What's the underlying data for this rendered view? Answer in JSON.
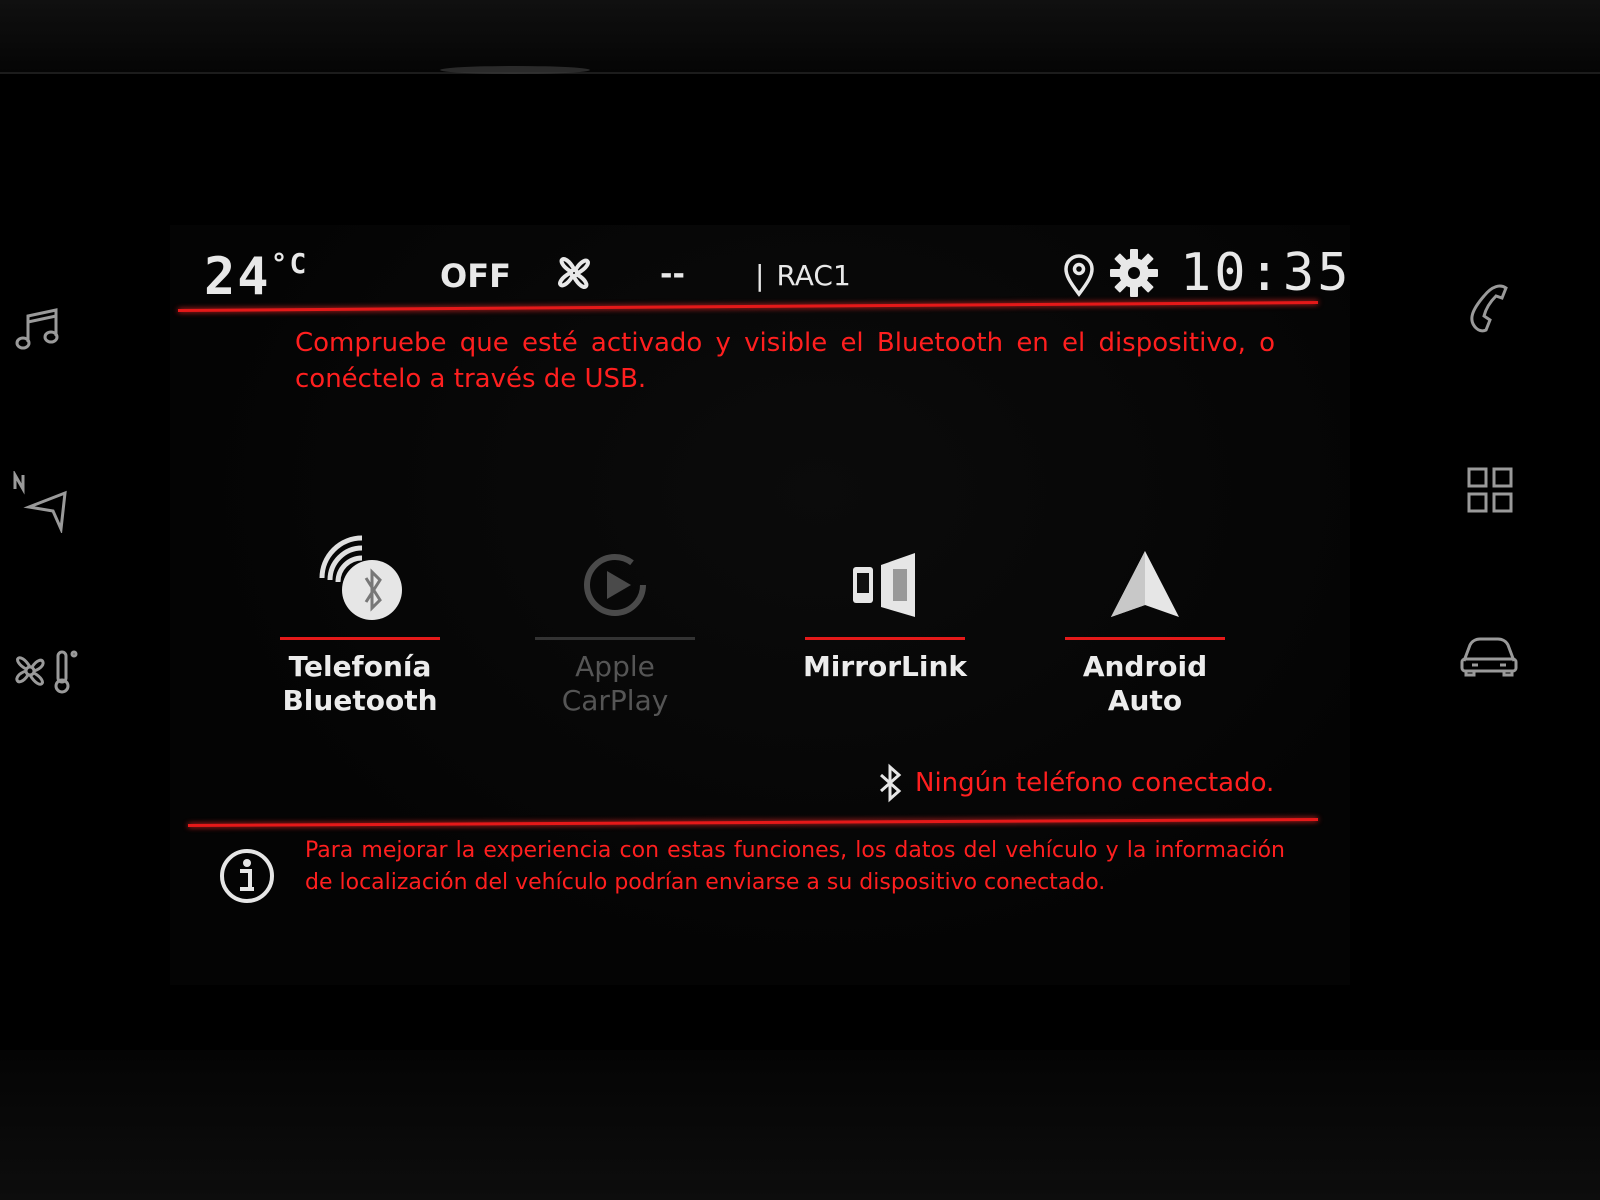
{
  "status_bar": {
    "temperature": "24",
    "temperature_unit": "°C",
    "fan_state": "OFF",
    "fan_level": "--",
    "radio_separator": "|",
    "radio_station": "RAC1",
    "clock": "10:35",
    "icons": [
      "fan-icon",
      "location-pin-icon",
      "gear-icon"
    ]
  },
  "alert_message": "Compruebe que esté activado y visible el Bluetooth en el dispositivo, o conéctelo a través de USB.",
  "connectivity_options": [
    {
      "label_line1": "Telefonía",
      "label_line2": "Bluetooth",
      "icon": "bluetooth-phone-icon",
      "enabled": true
    },
    {
      "label_line1": "Apple CarPlay",
      "label_line2": "",
      "icon": "carplay-icon",
      "enabled": false
    },
    {
      "label_line1": "MirrorLink",
      "label_line2": "",
      "icon": "mirrorlink-icon",
      "enabled": true
    },
    {
      "label_line1": "Android Auto",
      "label_line2": "",
      "icon": "android-auto-icon",
      "enabled": true
    }
  ],
  "phone_status": "Ningún teléfono conectado.",
  "info_message": "Para mejorar la experiencia con estas funciones, los datos del vehículo y la información de localización del vehículo podrían enviarse a su dispositivo conectado.",
  "side_left_icons": [
    "music-icon",
    "navigation-icon",
    "climate-icon"
  ],
  "side_right_icons": [
    "phone-icon",
    "apps-grid-icon",
    "car-icon"
  ],
  "colors": {
    "accent_red": "#e51919",
    "text_red": "#ff1f1f",
    "text_white": "#ececec",
    "background": "#000000"
  }
}
